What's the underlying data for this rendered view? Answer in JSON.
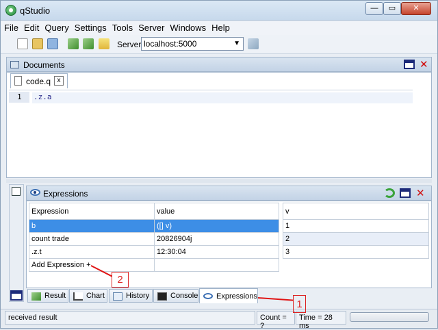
{
  "window": {
    "title": "qStudio"
  },
  "menu": [
    "File",
    "Edit",
    "Query",
    "Settings",
    "Tools",
    "Server",
    "Windows",
    "Help"
  ],
  "toolbar": {
    "server_label": "Server:",
    "server_value": "localhost:5000"
  },
  "documents": {
    "title": "Documents",
    "tab_label": "code.q",
    "tab_close": "x",
    "line_number": "1",
    "code": ".z.a"
  },
  "expressions": {
    "title": "Expressions",
    "columns": [
      "Expression",
      "value"
    ],
    "rows": [
      {
        "expr": "b",
        "value": "([] v)"
      },
      {
        "expr": "count trade",
        "value": "20826904j"
      },
      {
        "expr": ".z.t",
        "value": "12:30:04"
      }
    ],
    "add_label": "Add Expression +",
    "side_column": "v",
    "side_values": [
      "1",
      "2",
      "3"
    ]
  },
  "bottom_tabs": [
    "Result",
    "Chart",
    "History",
    "Console",
    "Expressions"
  ],
  "status": {
    "message": "received result",
    "count": "Count = ?",
    "time": "Time = 28 ms"
  },
  "annotations": [
    "1",
    "2"
  ],
  "colors": {
    "selection": "#3d8ee6",
    "annotation": "#e01515",
    "close": "#d01010"
  }
}
